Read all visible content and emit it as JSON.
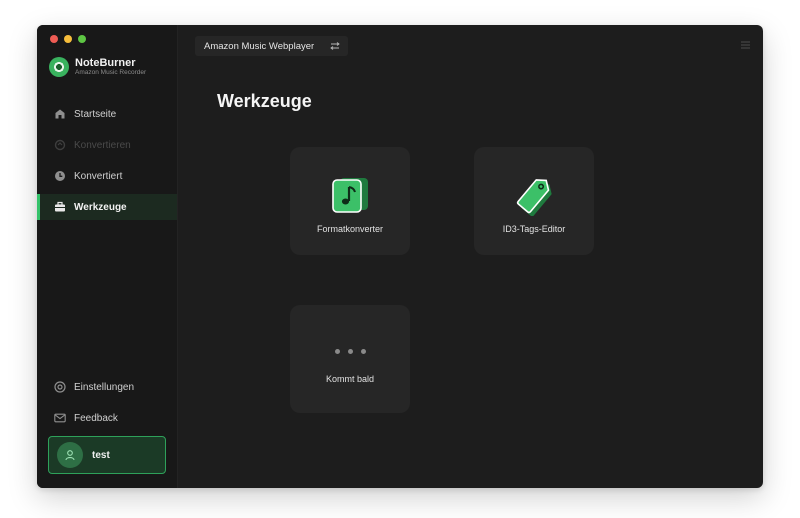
{
  "app": {
    "name": "NoteBurner",
    "subtitle": "Amazon Music Recorder"
  },
  "sidebar": {
    "items": [
      {
        "label": "Startseite",
        "icon": "home-icon",
        "state": "normal"
      },
      {
        "label": "Konvertieren",
        "icon": "convert-icon",
        "state": "disabled"
      },
      {
        "label": "Konvertiert",
        "icon": "clock-icon",
        "state": "normal"
      },
      {
        "label": "Werkzeuge",
        "icon": "toolbox-icon",
        "state": "active"
      }
    ],
    "bottom_items": [
      {
        "label": "Einstellungen",
        "icon": "gear-icon"
      },
      {
        "label": "Feedback",
        "icon": "mail-icon"
      }
    ],
    "user": {
      "name": "test"
    }
  },
  "topbar": {
    "source_label": "Amazon Music Webplayer"
  },
  "main": {
    "title": "Werkzeuge",
    "tools": [
      {
        "label": "Formatkonverter",
        "icon": "music-file-icon"
      },
      {
        "label": "ID3-Tags-Editor",
        "icon": "tag-icon"
      },
      {
        "label": "Kommt bald",
        "icon": "more-dots-icon"
      }
    ]
  },
  "colors": {
    "accent": "#34c26a",
    "window_bg": "#1d1d1d",
    "sidebar_bg": "#181818",
    "card_bg": "#262626"
  }
}
